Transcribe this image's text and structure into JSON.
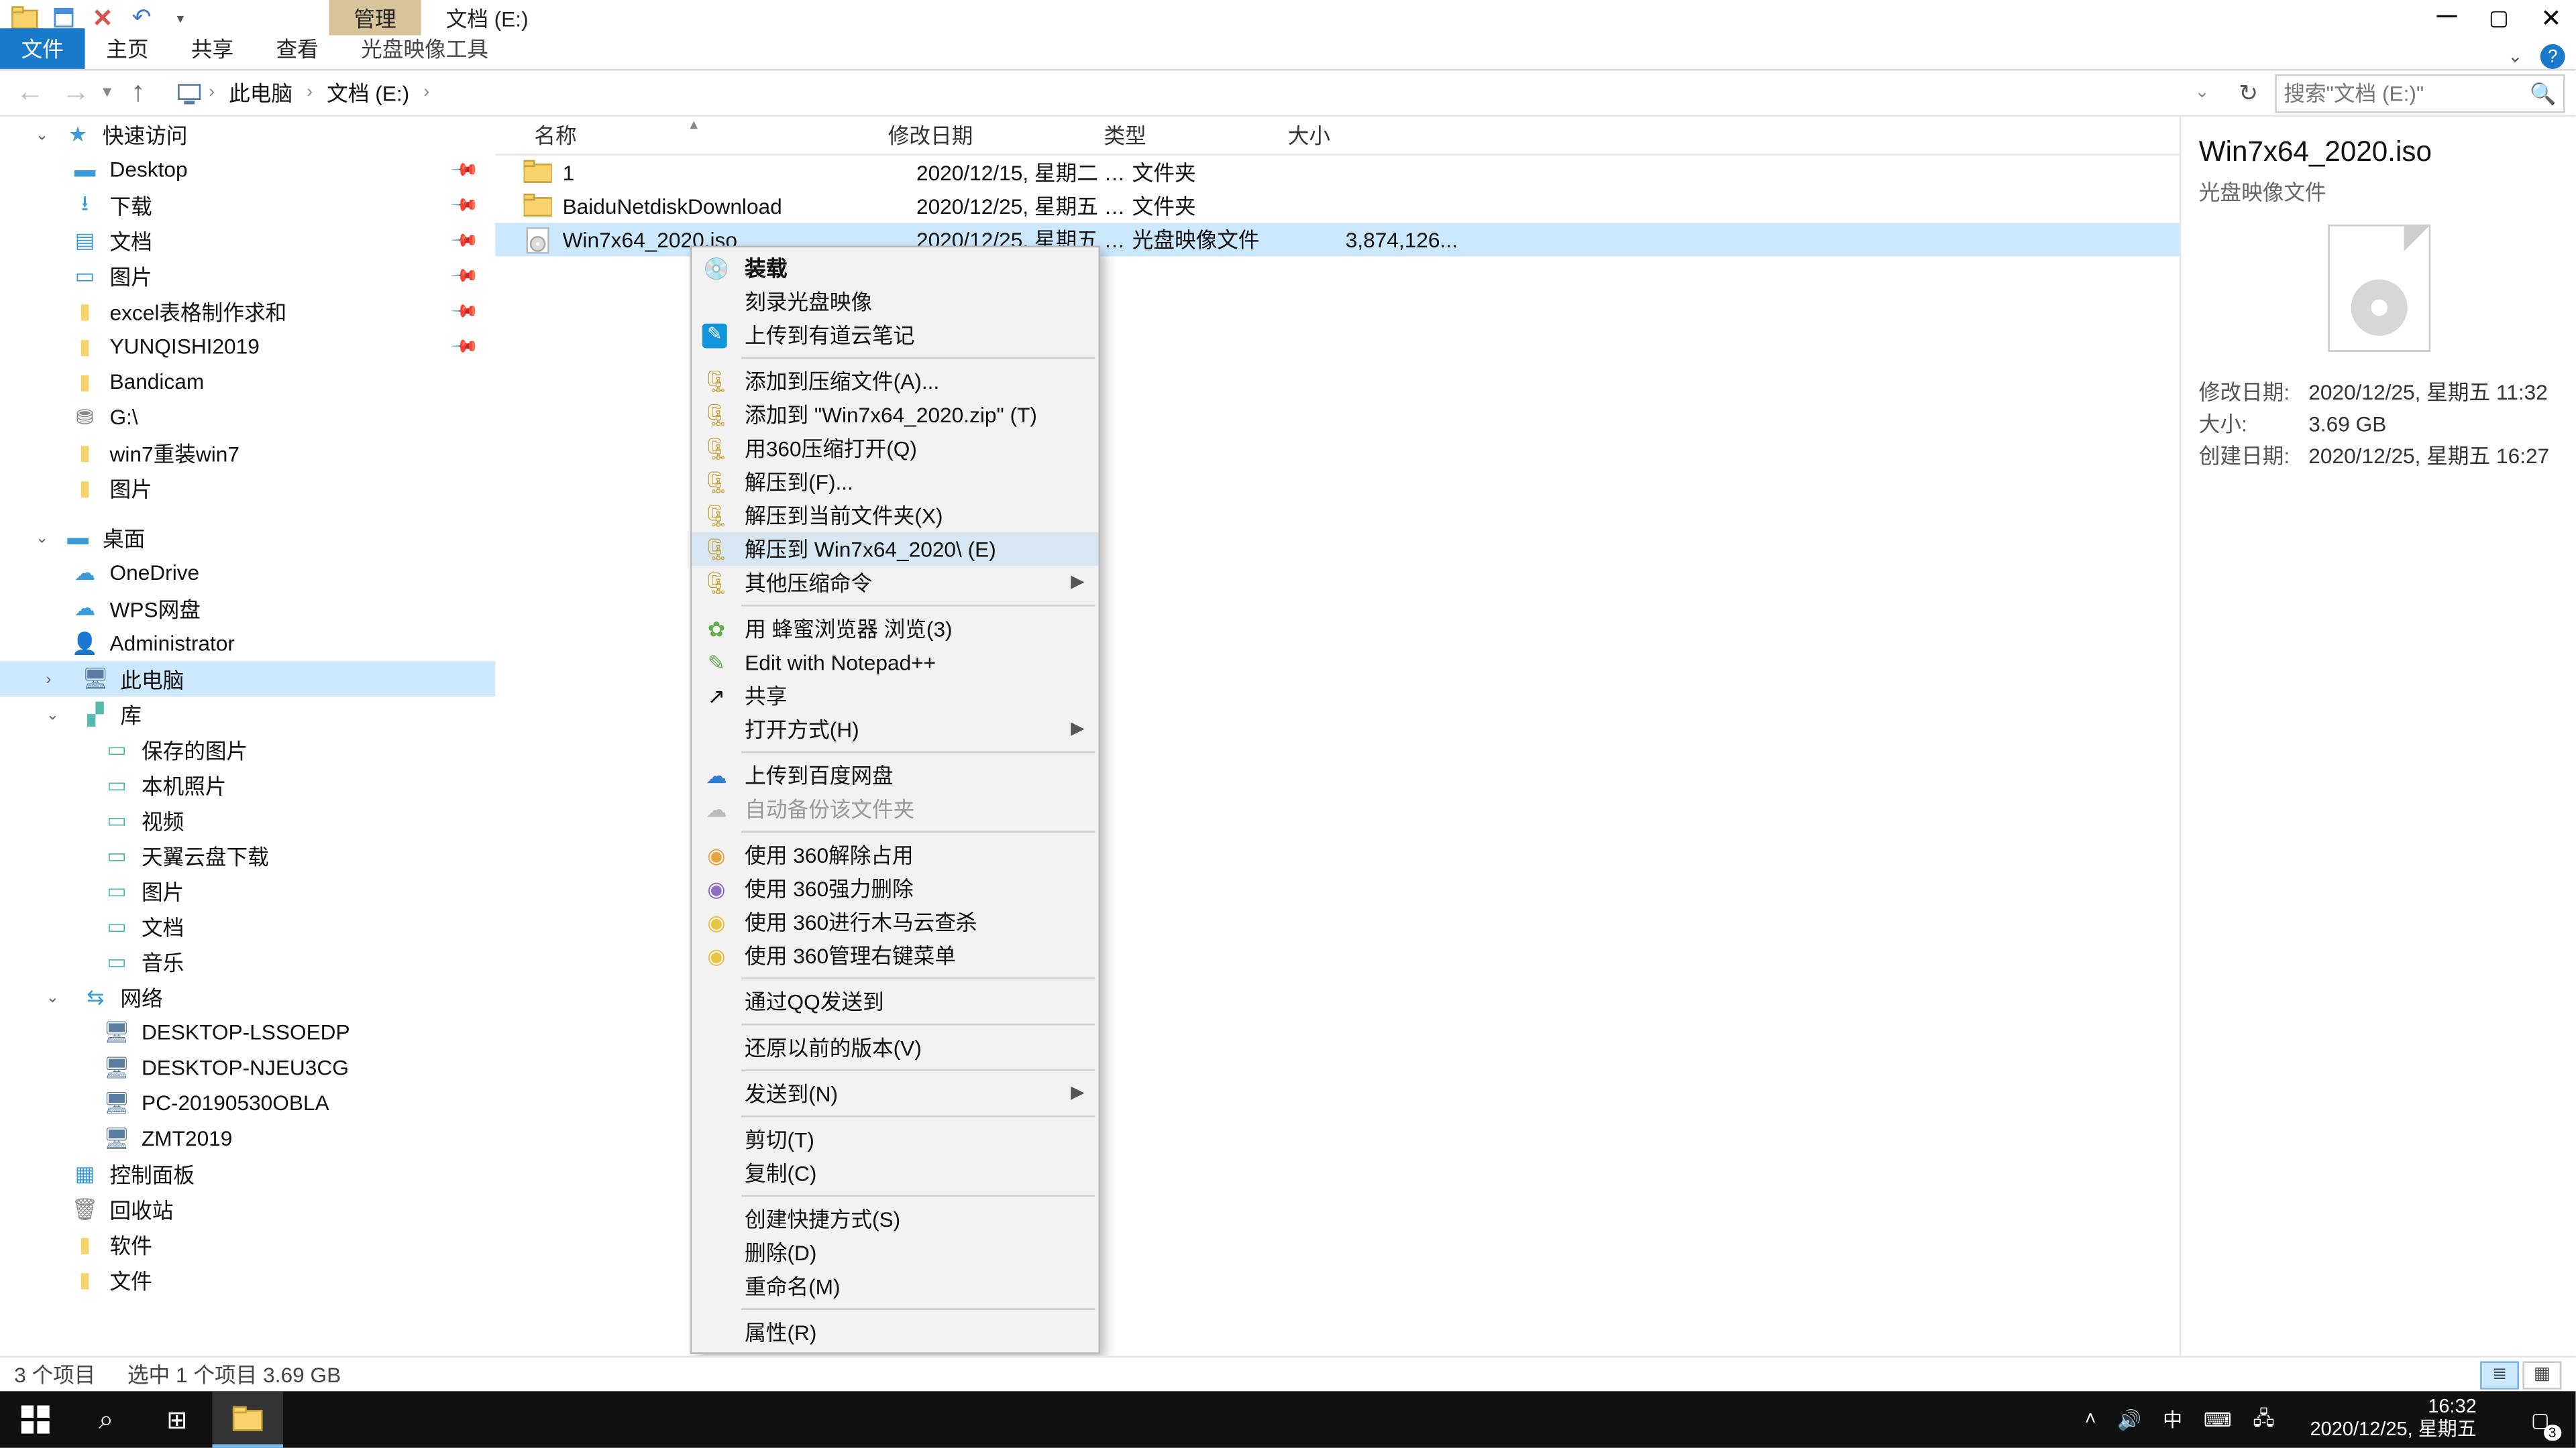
{
  "window": {
    "title_context_tab": "管理",
    "drive_title": "文档 (E:)",
    "ribbon_context_tool": "光盘映像工具"
  },
  "ribbon_tabs": {
    "file": "文件",
    "home": "主页",
    "share": "共享",
    "view": "查看"
  },
  "breadcrumb": {
    "root": "此电脑",
    "node": "文档 (E:)"
  },
  "search": {
    "placeholder": "搜索\"文档 (E:)\""
  },
  "nav": {
    "quick": "快速访问",
    "desktop": "Desktop",
    "downloads": "下载",
    "documents": "文档",
    "pictures": "图片",
    "excel": "excel表格制作求和",
    "yunqishi": "YUNQISHI2019",
    "bandicam": "Bandicam",
    "g_drive": "G:\\",
    "win7rein": "win7重装win7",
    "pictures2": "图片",
    "desktop_section": "桌面",
    "onedrive": "OneDrive",
    "wps": "WPS网盘",
    "admin": "Administrator",
    "thispc": "此电脑",
    "libraries": "库",
    "saved_pics": "保存的图片",
    "local_photos": "本机照片",
    "videos": "视频",
    "tianyi": "天翼云盘下载",
    "pics_lib": "图片",
    "docs_lib": "文档",
    "music_lib": "音乐",
    "network": "网络",
    "net1": "DESKTOP-LSSOEDP",
    "net2": "DESKTOP-NJEU3CG",
    "net3": "PC-20190530OBLA",
    "net4": "ZMT2019",
    "ctrl_panel": "控制面板",
    "recycle": "回收站",
    "software": "软件",
    "docs_bottom": "文件"
  },
  "cols": {
    "name": "名称",
    "date": "修改日期",
    "type": "类型",
    "size": "大小"
  },
  "rows": [
    {
      "name": "1",
      "date": "2020/12/15, 星期二 1...",
      "type": "文件夹",
      "size": "",
      "icon": "folder"
    },
    {
      "name": "BaiduNetdiskDownload",
      "date": "2020/12/25, 星期五 1...",
      "type": "文件夹",
      "size": "",
      "icon": "folder"
    },
    {
      "name": "Win7x64_2020.iso",
      "date": "2020/12/25, 星期五 1...",
      "type": "光盘映像文件",
      "size": "3,874,126...",
      "icon": "iso"
    }
  ],
  "ctx": {
    "mount": "装载",
    "burn": "刻录光盘映像",
    "youdao": "上传到有道云笔记",
    "addarc": "添加到压缩文件(A)...",
    "addzip": "添加到 \"Win7x64_2020.zip\" (T)",
    "open360": "用360压缩打开(Q)",
    "extract": "解压到(F)...",
    "extract_here": "解压到当前文件夹(X)",
    "extract_named": "解压到 Win7x64_2020\\ (E)",
    "other_arc": "其他压缩命令",
    "bee": "用 蜂蜜浏览器 浏览(3)",
    "npp": "Edit with Notepad++",
    "share": "共享",
    "openwith": "打开方式(H)",
    "baidu_up": "上传到百度网盘",
    "auto_bak": "自动备份该文件夹",
    "unlock360": "使用 360解除占用",
    "forcedelete": "使用 360强力删除",
    "trojan": "使用 360进行木马云查杀",
    "manage_ctx": "使用 360管理右键菜单",
    "qq_send": "通过QQ发送到",
    "restore_prev": "还原以前的版本(V)",
    "sendto": "发送到(N)",
    "cut": "剪切(T)",
    "copy": "复制(C)",
    "shortcut": "创建快捷方式(S)",
    "delete": "删除(D)",
    "rename": "重命名(M)",
    "props": "属性(R)"
  },
  "details": {
    "title": "Win7x64_2020.iso",
    "type": "光盘映像文件",
    "mod_k": "修改日期:",
    "mod_v": "2020/12/25, 星期五 11:32",
    "size_k": "大小:",
    "size_v": "3.69 GB",
    "create_k": "创建日期:",
    "create_v": "2020/12/25, 星期五 16:27"
  },
  "status": {
    "count": "3 个项目",
    "sel": "选中 1 个项目  3.69 GB"
  },
  "taskbar": {
    "ime": "中",
    "time": "16:32",
    "date": "2020/12/25, 星期五",
    "notif_count": "3"
  }
}
